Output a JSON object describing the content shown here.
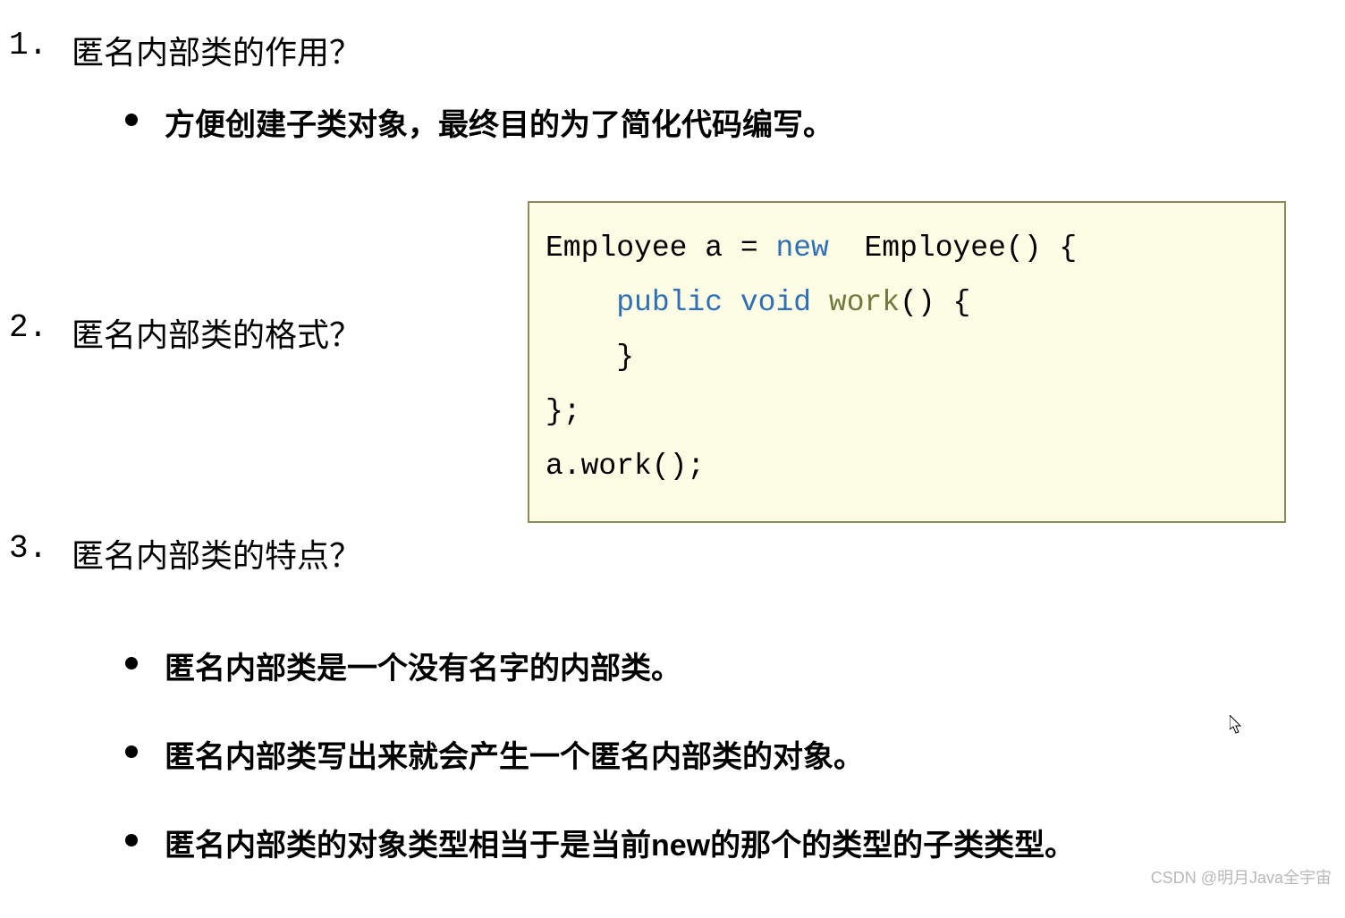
{
  "sections": [
    {
      "number": "1.",
      "question": "匿名内部类的作用？",
      "bullets": [
        "方便创建子类对象，最终目的为了简化代码编写。"
      ]
    },
    {
      "number": "2.",
      "question": "匿名内部类的格式？",
      "bullets": []
    },
    {
      "number": "3.",
      "question": "匿名内部类的特点？",
      "bullets": [
        "匿名内部类是一个没有名字的内部类。",
        "匿名内部类写出来就会产生一个匿名内部类的对象。",
        "匿名内部类的对象类型相当于是当前new的那个的类型的子类类型。"
      ]
    }
  ],
  "code": {
    "line1_prefix": "Employee a = ",
    "line1_new": "new",
    "line1_suffix": "  Employee() {",
    "line2_indent": "    ",
    "line2_public": "public",
    "line2_space1": " ",
    "line2_void": "void",
    "line2_space2": " ",
    "line2_method": "work",
    "line2_suffix": "() {",
    "line3": "    }",
    "line4": "};",
    "line5": "a.work();"
  },
  "watermark": "CSDN @明月Java全宇宙"
}
